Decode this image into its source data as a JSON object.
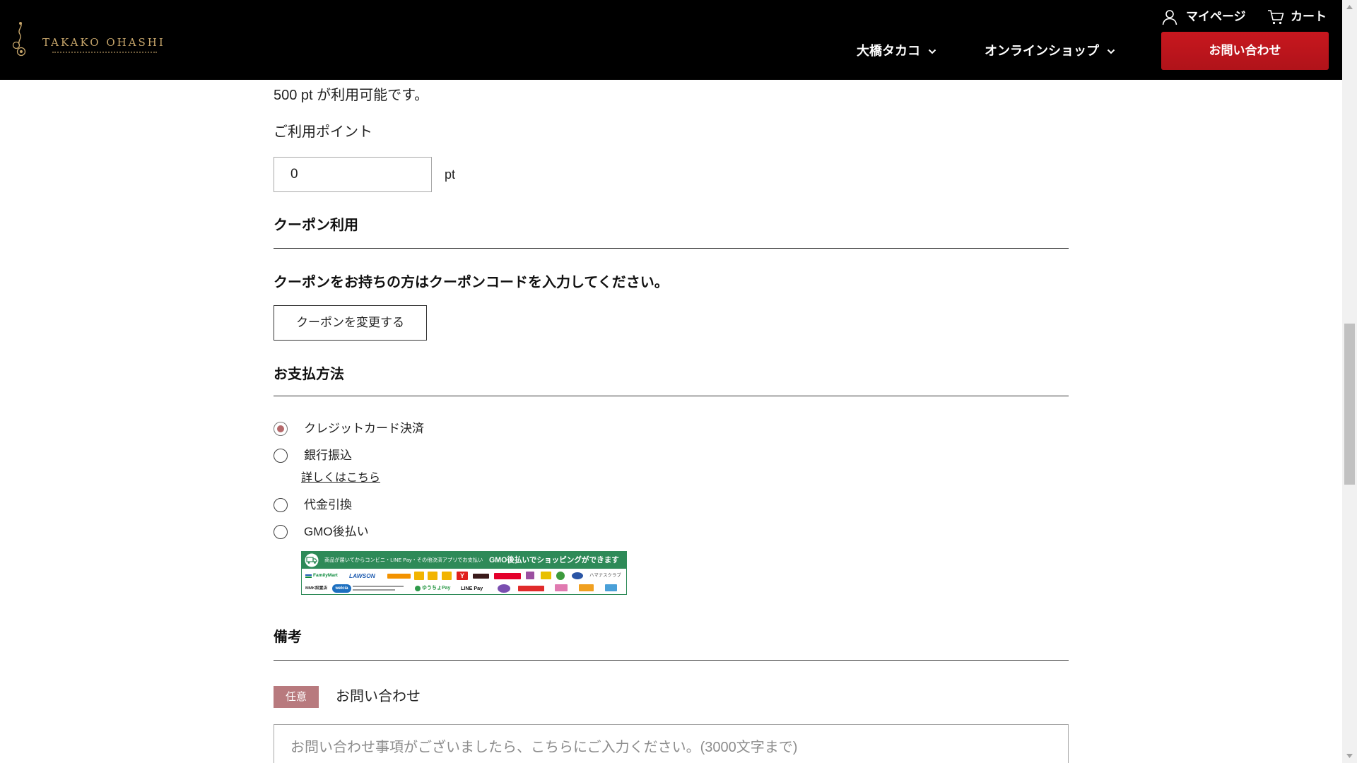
{
  "header": {
    "logo_text": "TAKAKO OHASHI",
    "mypage_label": "マイページ",
    "cart_label": "カート",
    "nav": [
      {
        "label": "大橋タカコ"
      },
      {
        "label": "オンラインショップ"
      }
    ],
    "contact_button": "お問い合わせ",
    "icons": {
      "logo_mark": "flower-ornament-icon",
      "mypage": "user-icon",
      "cart": "cart-icon",
      "nav_chevron": "chevron-down-icon"
    }
  },
  "points": {
    "available_text": "500 pt が利用可能です。",
    "label": "ご利用ポイント",
    "value": "0",
    "unit": "pt"
  },
  "coupon": {
    "heading": "クーポン利用",
    "description": "クーポンをお持ちの方はクーポンコードを入力してください。",
    "button": "クーポンを変更する"
  },
  "payment": {
    "heading": "お支払方法",
    "options": [
      {
        "label": "クレジットカード決済",
        "selected": true
      },
      {
        "label": "銀行振込",
        "selected": false,
        "link": "詳しくはこちら"
      },
      {
        "label": "代金引換",
        "selected": false
      },
      {
        "label": "GMO後払い",
        "selected": false
      }
    ],
    "gmo_banner": {
      "icon": "truck-icon",
      "header_text": "商品が届いてからコンビニ・LINE Pay・その他決済アプリでお支払い",
      "header_emphasis": "GMO後払いでショッピングができます",
      "row1": [
        {
          "icon": "familymart-logo",
          "text": "FamilyMart",
          "color": "#0c8a3c"
        },
        {
          "icon": "lawson-logo",
          "text": "LAWSON",
          "color": "#1f5cb0"
        },
        {
          "icon": "orange-store-logo",
          "color": "#f39200"
        },
        {
          "icon": "yellow-store-logo-1",
          "color": "#f2b400"
        },
        {
          "icon": "yellow-store-logo-2",
          "color": "#f2b400"
        },
        {
          "icon": "yellow-store-logo-3",
          "color": "#f2b400"
        },
        {
          "icon": "red-y-store-logo",
          "text": "Y",
          "color": "#e0201c"
        },
        {
          "icon": "dark-store-logo",
          "color": "#3a1a1a"
        },
        {
          "icon": "red-store-logo",
          "color": "#e4002b"
        },
        {
          "icon": "purple-store-logo",
          "color": "#9b4fa0"
        },
        {
          "icon": "yellow-square-logo",
          "color": "#e8c000"
        },
        {
          "icon": "green-round-logo",
          "color": "#3c9a3c"
        },
        {
          "icon": "blue-round-logo",
          "color": "#2a55a5"
        },
        {
          "icon": "hamanasu-club-logo",
          "text": "ハマナスクラブ",
          "color": "#555555"
        }
      ],
      "row2": [
        {
          "icon": "mmk-logo",
          "text": "MMK設置店",
          "color": "#333333"
        },
        {
          "icon": "welcia-logo",
          "text": "welcia",
          "color": "#1c6fc0"
        },
        {
          "icon": "welcia-note",
          "color": "#9a9a9a"
        },
        {
          "icon": "yucho-pay-logo",
          "text": "ゆうちょPay",
          "color": "#2e9a4a"
        },
        {
          "icon": "line-pay-logo",
          "text": "LINE Pay",
          "color": "#111111"
        },
        {
          "icon": "purple-pay-logo",
          "color": "#7a4fb0"
        },
        {
          "icon": "red-pay-logo",
          "color": "#e02a2a"
        },
        {
          "icon": "pink-pay-logo",
          "color": "#e07ab0"
        },
        {
          "icon": "orange-pay-logo",
          "color": "#f0a020"
        },
        {
          "icon": "blue-pay-logo",
          "color": "#4aa0d8"
        }
      ]
    }
  },
  "notes": {
    "heading": "備考",
    "badge": "任意",
    "label": "お問い合わせ",
    "placeholder": "お問い合わせ事項がございましたら、こちらにご入力ください。(3000文字まで)"
  },
  "scrollbar": {
    "scroll_position_fraction": 0.54,
    "visible_fraction": 0.22
  },
  "colors": {
    "header_bg": "#000000",
    "accent": "#c8171e",
    "accent_dark": "#b0131a",
    "logo_gold": "#c6a56a",
    "badge": "#b87a7e",
    "radio_selected": "#b5696b",
    "banner_green": "#2e8a58",
    "rule": "#333333",
    "text": "#222222",
    "placeholder": "#8c8c8c"
  }
}
